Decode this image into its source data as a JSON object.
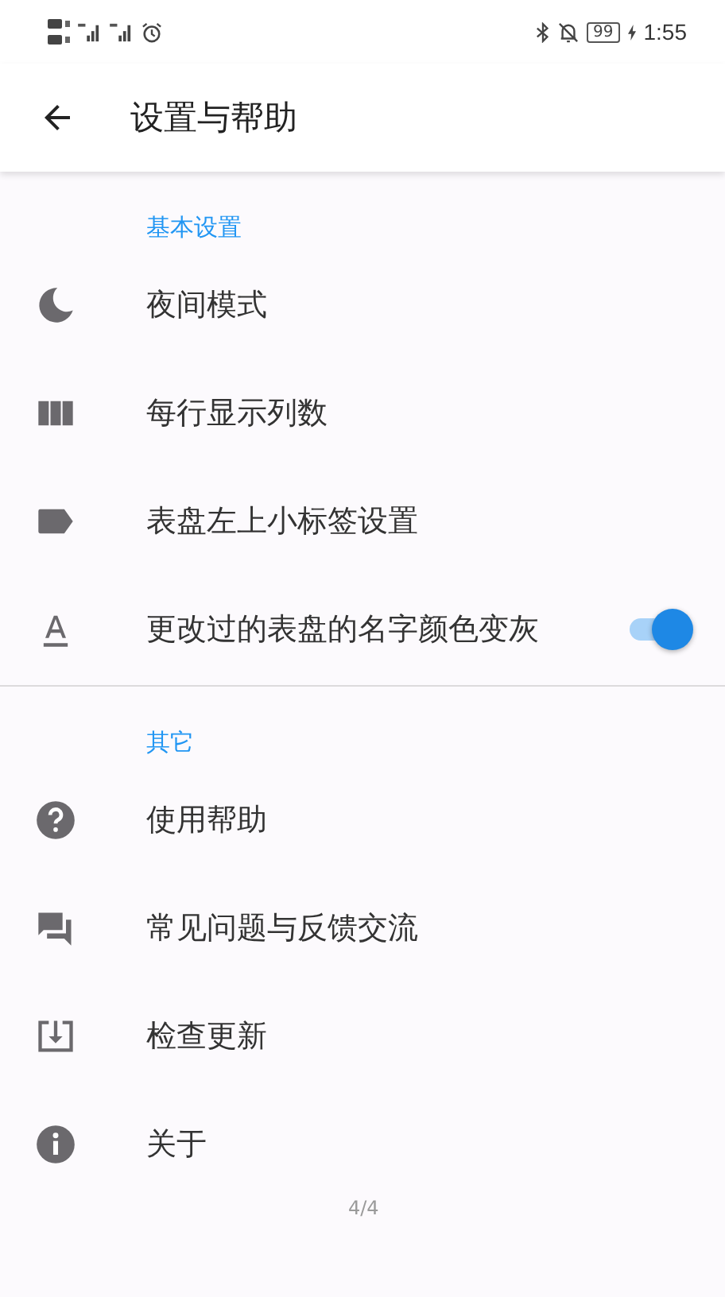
{
  "status_bar": {
    "battery": "99",
    "time": "1:55"
  },
  "app_bar": {
    "title": "设置与帮助"
  },
  "sections": [
    {
      "header": "基本设置",
      "items": [
        {
          "kind": "link",
          "label": "夜间模式"
        },
        {
          "kind": "link",
          "label": "每行显示列数"
        },
        {
          "kind": "link",
          "label": "表盘左上小标签设置"
        },
        {
          "kind": "switch",
          "label": "更改过的表盘的名字颜色变灰",
          "on": true
        }
      ]
    },
    {
      "header": "其它",
      "items": [
        {
          "kind": "link",
          "label": "使用帮助"
        },
        {
          "kind": "link",
          "label": "常见问题与反馈交流"
        },
        {
          "kind": "link",
          "label": "检查更新"
        },
        {
          "kind": "link",
          "label": "关于"
        }
      ]
    }
  ],
  "page_indicator": "4/4"
}
